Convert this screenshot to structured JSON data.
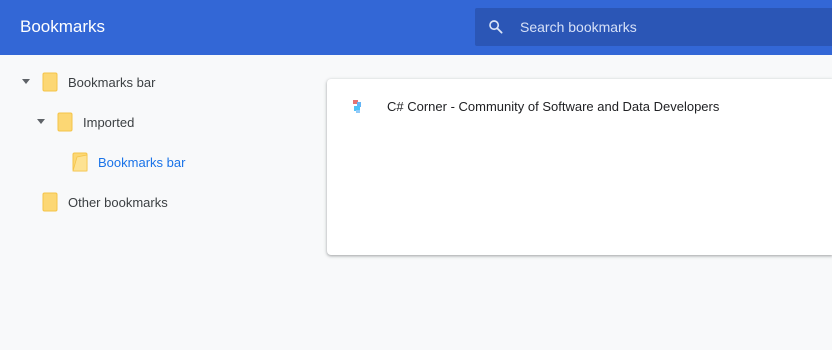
{
  "header": {
    "title": "Bookmarks",
    "search": {
      "placeholder": "Search bookmarks",
      "value": "",
      "icon": "search-icon"
    }
  },
  "colors": {
    "header_bg": "#3367d6",
    "search_bg": "#2b56b6",
    "folder": "#fcd774",
    "selected_text": "#1a73e8",
    "page_bg": "#f8f9fa"
  },
  "sidebar": {
    "items": [
      {
        "label": "Bookmarks bar",
        "expanded": true,
        "selected": false,
        "icon": "folder-icon"
      },
      {
        "label": "Imported",
        "expanded": true,
        "selected": false,
        "icon": "folder-icon"
      },
      {
        "label": "Bookmarks bar",
        "expanded": false,
        "selected": true,
        "icon": "folder-open-icon"
      },
      {
        "label": "Other bookmarks",
        "expanded": false,
        "selected": false,
        "icon": "folder-icon"
      }
    ]
  },
  "main": {
    "bookmarks": [
      {
        "title": "C# Corner - Community of Software and Data Developers",
        "icon": "favicon-icon"
      }
    ]
  }
}
